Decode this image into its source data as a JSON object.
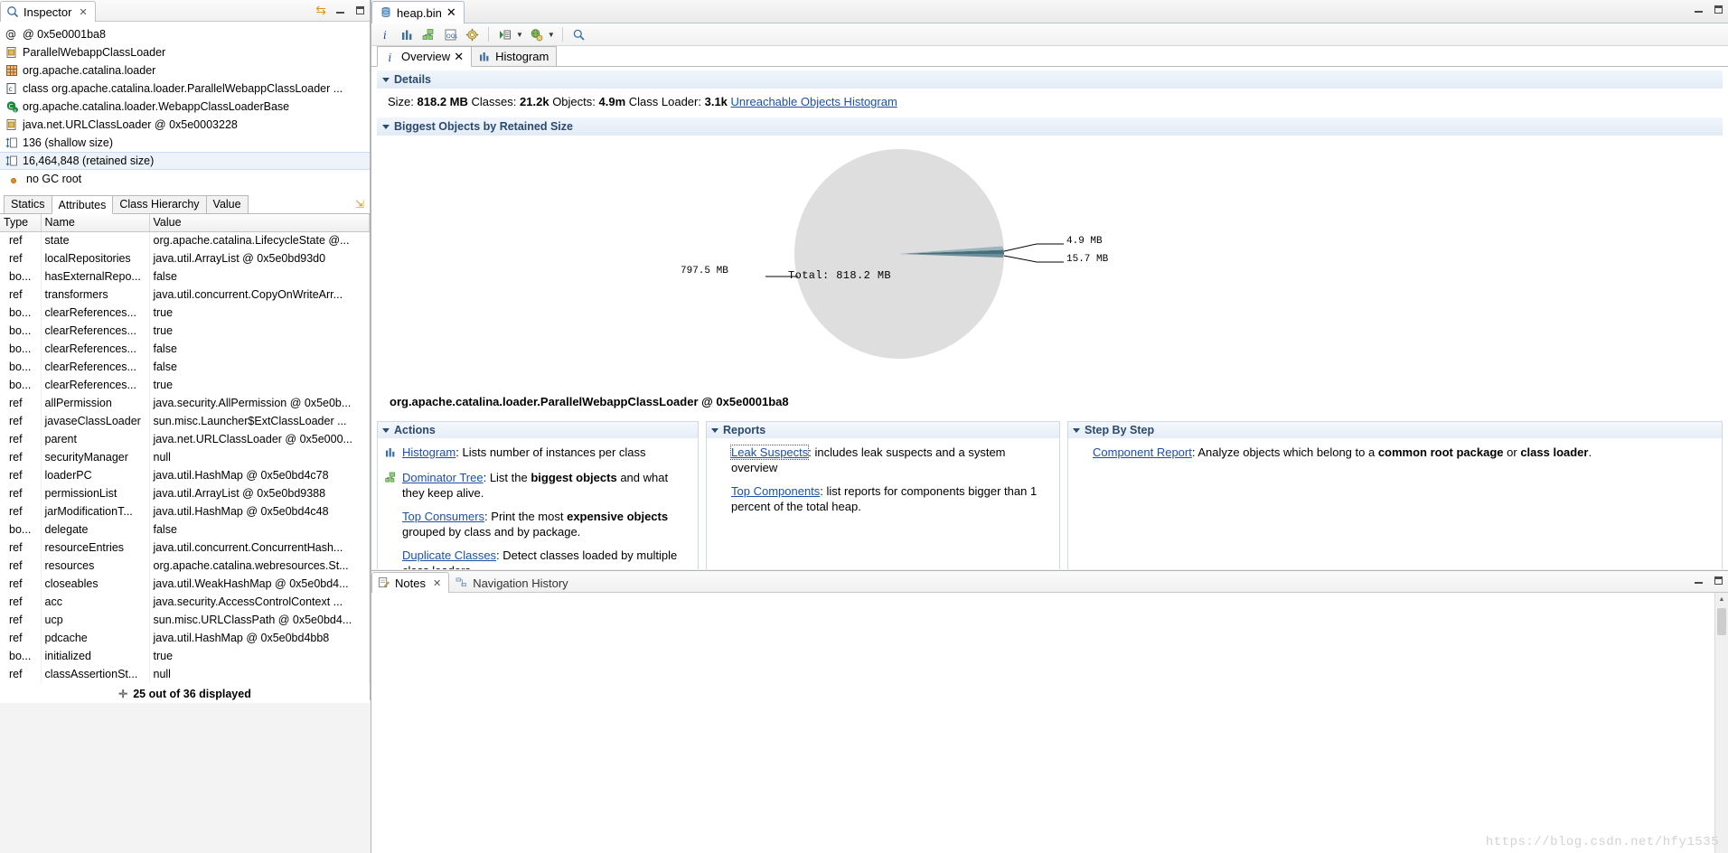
{
  "inspector": {
    "title": "Inspector",
    "close_label": "✕",
    "rows": [
      {
        "icon": "at-icon",
        "text": "@ 0x5e0001ba8"
      },
      {
        "icon": "object-icon",
        "text": "ParallelWebappClassLoader"
      },
      {
        "icon": "package-icon",
        "text": "org.apache.catalina.loader"
      },
      {
        "icon": "class-icon",
        "text": "class org.apache.catalina.loader.ParallelWebappClassLoader ..."
      },
      {
        "icon": "superclass-icon",
        "text": "org.apache.catalina.loader.WebappClassLoaderBase"
      },
      {
        "icon": "classloader-icon",
        "text": "java.net.URLClassLoader @ 0x5e0003228"
      },
      {
        "icon": "size-icon",
        "text": "136 (shallow size)"
      },
      {
        "icon": "size-icon",
        "text": "16,464,848 (retained size)"
      },
      {
        "icon": "gcroot-icon",
        "text": "no GC root"
      }
    ],
    "selected_row_index": 7,
    "tabs": [
      {
        "label": "Statics",
        "active": false
      },
      {
        "label": "Attributes",
        "active": true
      },
      {
        "label": "Class Hierarchy",
        "active": false
      },
      {
        "label": "Value",
        "active": false
      }
    ],
    "table": {
      "columns": [
        "Type",
        "Name",
        "Value"
      ],
      "rows": [
        [
          "ref",
          "state",
          "org.apache.catalina.LifecycleState @..."
        ],
        [
          "ref",
          "localRepositories",
          "java.util.ArrayList @ 0x5e0bd93d0"
        ],
        [
          "bo...",
          "hasExternalRepo...",
          "false"
        ],
        [
          "ref",
          "transformers",
          "java.util.concurrent.CopyOnWriteArr..."
        ],
        [
          "bo...",
          "clearReferences...",
          "true"
        ],
        [
          "bo...",
          "clearReferences...",
          "true"
        ],
        [
          "bo...",
          "clearReferences...",
          "false"
        ],
        [
          "bo...",
          "clearReferences...",
          "false"
        ],
        [
          "bo...",
          "clearReferences...",
          "true"
        ],
        [
          "ref",
          "allPermission",
          "java.security.AllPermission @ 0x5e0b..."
        ],
        [
          "ref",
          "javaseClassLoader",
          "sun.misc.Launcher$ExtClassLoader ..."
        ],
        [
          "ref",
          "parent",
          "java.net.URLClassLoader @ 0x5e000..."
        ],
        [
          "ref",
          "securityManager",
          "null"
        ],
        [
          "ref",
          "loaderPC",
          "java.util.HashMap @ 0x5e0bd4c78"
        ],
        [
          "ref",
          "permissionList",
          "java.util.ArrayList @ 0x5e0bd9388"
        ],
        [
          "ref",
          "jarModificationT...",
          "java.util.HashMap @ 0x5e0bd4c48"
        ],
        [
          "bo...",
          "delegate",
          "false"
        ],
        [
          "ref",
          "resourceEntries",
          "java.util.concurrent.ConcurrentHash..."
        ],
        [
          "ref",
          "resources",
          "org.apache.catalina.webresources.St..."
        ],
        [
          "ref",
          "closeables",
          "java.util.WeakHashMap @ 0x5e0bd4..."
        ],
        [
          "ref",
          "acc",
          "java.security.AccessControlContext ..."
        ],
        [
          "ref",
          "ucp",
          "sun.misc.URLClassPath @ 0x5e0bd4..."
        ],
        [
          "ref",
          "pdcache",
          "java.util.HashMap @ 0x5e0bd4bb8"
        ],
        [
          "bo...",
          "initialized",
          "true"
        ],
        [
          "ref",
          "classAssertionSt...",
          "null"
        ]
      ],
      "footer": "25 out of 36 displayed",
      "footer_plus": "✛"
    }
  },
  "editor": {
    "tab": {
      "label": "heap.bin",
      "close_label": "✕",
      "icon": "heap-icon"
    },
    "toolbar": [
      {
        "name": "overview-info-icon",
        "glyph": "i"
      },
      {
        "name": "histogram-icon",
        "glyph": "bars"
      },
      {
        "name": "dominator-tree-icon",
        "glyph": "tree"
      },
      {
        "name": "oql-icon",
        "glyph": "oql"
      },
      {
        "name": "calculate-icon",
        "glyph": "gear"
      },
      {
        "name": "run-expert-icon",
        "glyph": "runlist"
      },
      {
        "name": "query-browser-icon",
        "glyph": "globe"
      },
      {
        "name": "search-icon",
        "glyph": "magnifier"
      }
    ],
    "inner_tabs": [
      {
        "label": "Overview",
        "icon": "info-icon",
        "active": true,
        "close_label": "✕"
      },
      {
        "label": "Histogram",
        "icon": "histogram-icon",
        "active": false,
        "close_label": ""
      }
    ],
    "details": {
      "header": "Details",
      "size_label": "Size:",
      "size_value": "818.2 MB",
      "classes_label": "Classes:",
      "classes_value": "21.2k",
      "objects_label": "Objects:",
      "objects_value": "4.9m",
      "classloader_label": "Class Loader:",
      "classloader_value": "3.1k",
      "link": "Unreachable Objects Histogram"
    },
    "biggest": {
      "header": "Biggest Objects by Retained Size",
      "caption": "org.apache.catalina.loader.ParallelWebappClassLoader @ 0x5e0001ba8"
    },
    "actions": {
      "header": "Actions",
      "items": [
        {
          "icon": "histogram-icon",
          "link": "Histogram",
          "text_plain_1": ": Lists number of instances per class",
          "bold": "",
          "text_plain_2": ""
        },
        {
          "icon": "dominator-tree-icon",
          "link": "Dominator Tree",
          "text_plain_1": ": List the ",
          "bold": "biggest objects",
          "text_plain_2": " and what they keep alive."
        },
        {
          "icon": "",
          "link": "Top Consumers",
          "text_plain_1": ": Print the most ",
          "bold": "expensive objects",
          "text_plain_2": " grouped by class and by package."
        },
        {
          "icon": "",
          "link": "Duplicate Classes",
          "text_plain_1": ": Detect classes loaded by multiple class loaders.",
          "bold": "",
          "text_plain_2": ""
        }
      ]
    },
    "reports": {
      "header": "Reports",
      "items": [
        {
          "link": "Leak Suspects",
          "focused": true,
          "text_plain_1": ": includes leak suspects and a system overview",
          "bold": "",
          "text_plain_2": ""
        },
        {
          "link": "Top Components",
          "focused": false,
          "text_plain_1": ": list reports for components bigger than 1 percent of the total heap.",
          "bold": "",
          "text_plain_2": ""
        }
      ]
    },
    "step_by_step": {
      "header": "Step By Step",
      "items": [
        {
          "link": "Component Report",
          "text_plain_1": ": Analyze objects which belong to a ",
          "bold": "common root package",
          "mid": " or ",
          "bold2": "class loader",
          "text_plain_2": "."
        }
      ]
    }
  },
  "notes": {
    "tabs": [
      {
        "label": "Notes",
        "icon": "notes-icon",
        "active": true,
        "close_label": "✕"
      },
      {
        "label": "Navigation History",
        "icon": "history-icon",
        "active": false,
        "close_label": ""
      }
    ]
  },
  "watermark": "https://blog.csdn.net/hfy1535",
  "chart_data": {
    "type": "pie",
    "title": "Biggest Objects by Retained Size",
    "subtitle": "org.apache.catalina.loader.ParallelWebappClassLoader @ 0x5e0001ba8",
    "total_label": "Total: 818.2 MB",
    "total_value": 818.2,
    "unit": "MB",
    "labels": [
      "797.5 MB",
      "4.9 MB",
      "15.7 MB"
    ],
    "values": [
      797.5,
      4.9,
      15.7
    ],
    "colors": [
      "#dedede",
      "#46707d",
      "#9cb4bc"
    ],
    "legend": "none",
    "grid": false
  }
}
